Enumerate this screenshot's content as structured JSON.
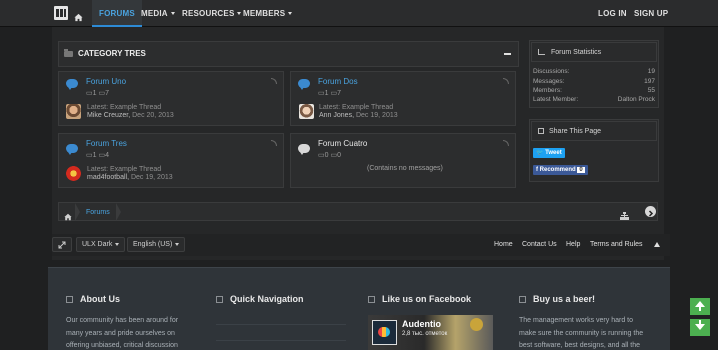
{
  "nav": {
    "home_icon": "home-icon",
    "items": [
      {
        "label": "FORUMS",
        "active": true
      },
      {
        "label": "MEDIA"
      },
      {
        "label": "RESOURCES"
      },
      {
        "label": "MEMBERS"
      }
    ],
    "login": "LOG IN",
    "signup": "SIGN UP"
  },
  "category": {
    "title": "CATEGORY TRES",
    "forums": [
      {
        "name": "Forum Uno",
        "threads": "1",
        "messages": "7",
        "latest": "Latest: Example Thread",
        "user": "Mike Creuzer",
        "date": "Dec 20, 2013"
      },
      {
        "name": "Forum Dos",
        "threads": "1",
        "messages": "7",
        "latest": "Latest: Example Thread",
        "user": "Ann Jones",
        "date": "Dec 19, 2013"
      },
      {
        "name": "Forum Tres",
        "threads": "1",
        "messages": "4",
        "latest": "Latest: Example Thread",
        "user": "mad4football",
        "date": "Dec 19, 2013"
      },
      {
        "name": "Forum Cuatro",
        "threads": "0",
        "messages": "0",
        "empty": "(Contains no messages)"
      }
    ]
  },
  "stats": {
    "title": "Forum Statistics",
    "rows": [
      {
        "k": "Discussions:",
        "v": "19"
      },
      {
        "k": "Messages:",
        "v": "197"
      },
      {
        "k": "Members:",
        "v": "55"
      },
      {
        "k": "Latest Member:",
        "v": "Dalton Prock"
      }
    ]
  },
  "share": {
    "title": "Share This Page",
    "tweet": "Tweet",
    "recommend": "Recommend",
    "recommend_count": "0"
  },
  "breadcrumb": {
    "item": "Forums"
  },
  "footer": {
    "style": "ULX Dark",
    "language": "English (US)",
    "links": [
      "Home",
      "Contact Us",
      "Help",
      "Terms and Rules"
    ]
  },
  "bottom": {
    "about": {
      "title": "About Us",
      "lines": [
        "Our community has been around for",
        "many years and pride ourselves on",
        "offering unbiased, critical discussion"
      ]
    },
    "quicknav": {
      "title": "Quick Navigation"
    },
    "facebook": {
      "title": "Like us on Facebook",
      "page": "Audentio",
      "likes": "2,8 тыс. отметок"
    },
    "beer": {
      "title": "Buy us a beer!",
      "lines": [
        "The management works very hard to",
        "make sure the community is running the",
        "best software, best designs, and all the"
      ]
    }
  },
  "colors": {
    "accent": "#4aa3df",
    "scroll_button": "#4caf50"
  }
}
